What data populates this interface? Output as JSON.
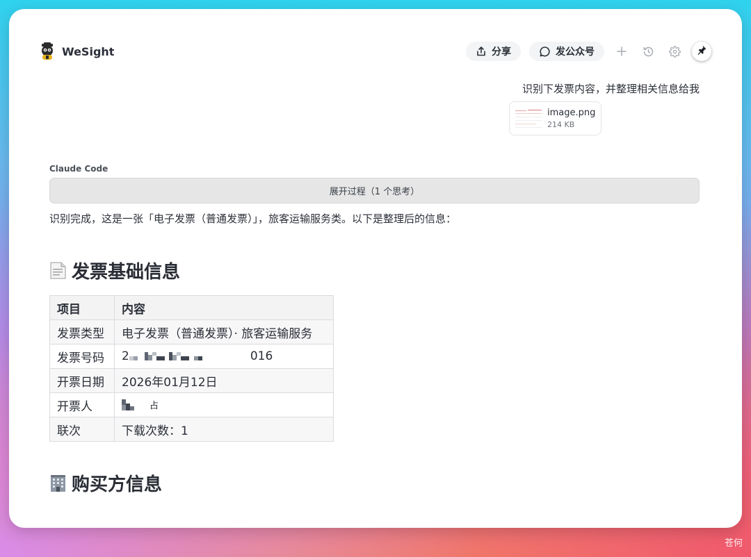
{
  "app": {
    "name": "WeSight",
    "logo_icon": "robot-mascot-icon"
  },
  "toolbar": {
    "share_label": "分享",
    "publish_label": "发公众号",
    "icons": [
      "share-icon",
      "chat-bubble-icon",
      "plus-icon",
      "history-icon",
      "gear-icon",
      "pin-icon"
    ]
  },
  "user_message": {
    "text": "识别下发票内容，并整理相关信息给我",
    "attachment": {
      "name": "image.png",
      "size": "214 KB"
    }
  },
  "assistant": {
    "agent_label": "Claude Code",
    "expand_label": "展开过程（1 个思考）",
    "intro": "识别完成，这是一张「电子发票（普通发票）」，旅客运输服务类。以下是整理后的信息："
  },
  "sections": {
    "basic": {
      "emoji": "page-facing-up-icon",
      "title": "发票基础信息"
    },
    "buyer": {
      "emoji": "office-building-icon",
      "title": "购买方信息"
    }
  },
  "basic_table": {
    "headers": [
      "项目",
      "内容"
    ],
    "rows": [
      {
        "item": "发票类型",
        "content": "电子发票（普通发票）· 旅客运输服务"
      },
      {
        "item": "发票号码",
        "content_prefix": "2",
        "content_suffix": "016"
      },
      {
        "item": "开票日期",
        "content": "2026年01月12日"
      },
      {
        "item": "开票人",
        "content_suffix": "占"
      },
      {
        "item": "联次",
        "content": "下载次数：1"
      }
    ]
  },
  "watermark": "苍何",
  "colors": {
    "window_bg": "#ffffff",
    "pill_bg": "#f2f4f5",
    "table_header_bg": "#f3f3f4",
    "expand_bar_bg": "#e6e6e6"
  }
}
